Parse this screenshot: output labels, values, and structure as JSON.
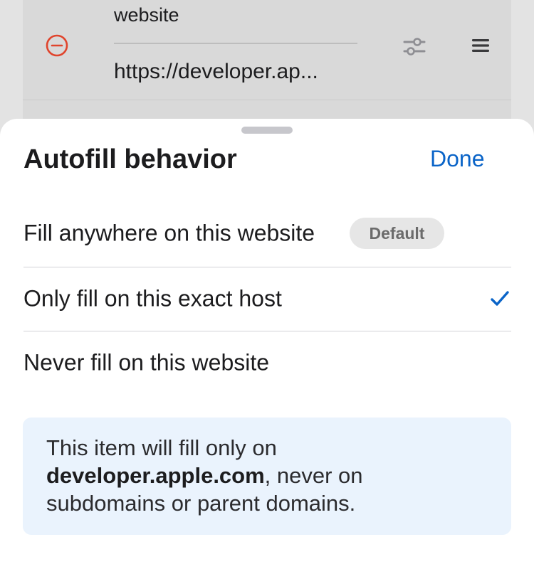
{
  "background_item": {
    "field_label": "website",
    "field_value": "https://developer.ap..."
  },
  "sheet": {
    "title": "Autofill behavior",
    "done_label": "Done",
    "options": [
      {
        "label": "Fill anywhere on this website",
        "badge": "Default",
        "selected": false
      },
      {
        "label": "Only fill on this exact host",
        "selected": true
      },
      {
        "label": "Never fill on this website",
        "selected": false
      }
    ],
    "info": {
      "prefix": "This item will fill only on",
      "host": "developer.apple.com",
      "suffix": ", never on subdomains or parent domains."
    }
  },
  "colors": {
    "accent": "#0a64c8",
    "remove": "#e0442c",
    "info_background": "#eaf3fd"
  },
  "icons": {
    "remove": "minus-circle-icon",
    "settings": "sliders-icon",
    "reorder": "reorder-icon",
    "selected": "checkmark-icon"
  }
}
